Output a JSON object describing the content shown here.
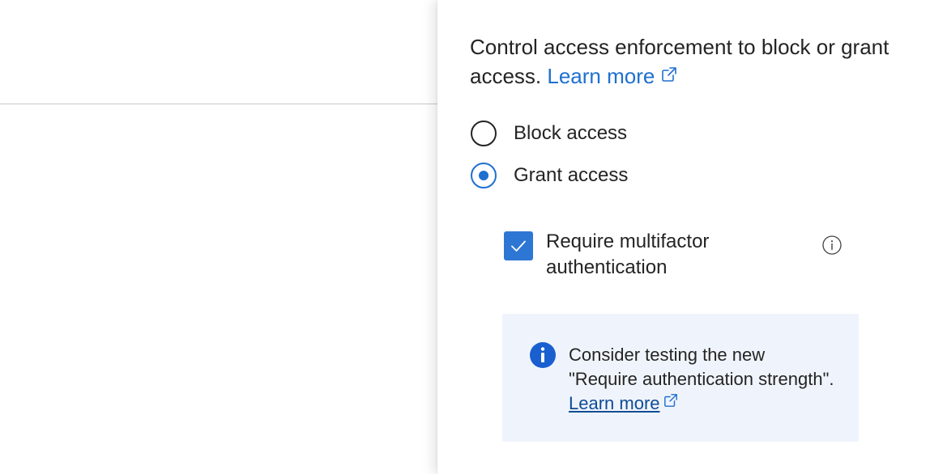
{
  "panel": {
    "description": "Control access enforcement to block or grant access.",
    "learn_more": "Learn more",
    "options": [
      {
        "label": "Block access",
        "selected": false
      },
      {
        "label": "Grant access",
        "selected": true
      }
    ],
    "grant_controls": [
      {
        "label": "Require multifactor authentication",
        "checked": true,
        "info_icon": "info-circle-icon"
      }
    ],
    "callout": {
      "icon": "info-filled-icon",
      "text": "Consider testing the new \"Require authentication strength\".",
      "link": "Learn more"
    }
  },
  "colors": {
    "accent": "#1f6fd0",
    "checkbox": "#2e76d4",
    "callout_bg": "#eff4fc",
    "callout_link": "#0f4c95",
    "text": "#242424"
  }
}
